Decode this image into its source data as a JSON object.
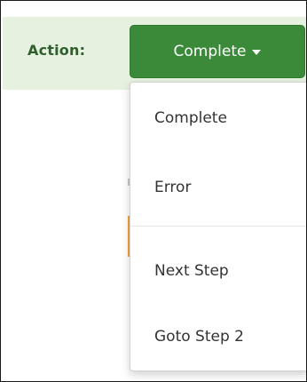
{
  "action_bar": {
    "label": "Action:",
    "button_label": "Complete",
    "button_icon": "caret-down-icon"
  },
  "dropdown": {
    "items": [
      {
        "label": "Complete"
      },
      {
        "label": "Error"
      },
      {
        "label": "Next Step"
      },
      {
        "label": "Goto Step 2"
      }
    ]
  },
  "colors": {
    "action_bar_bg": "#e6f2df",
    "button_green": "#3a8a3a",
    "label_green": "#2f5f2f",
    "accent_orange": "#f0a43a"
  }
}
